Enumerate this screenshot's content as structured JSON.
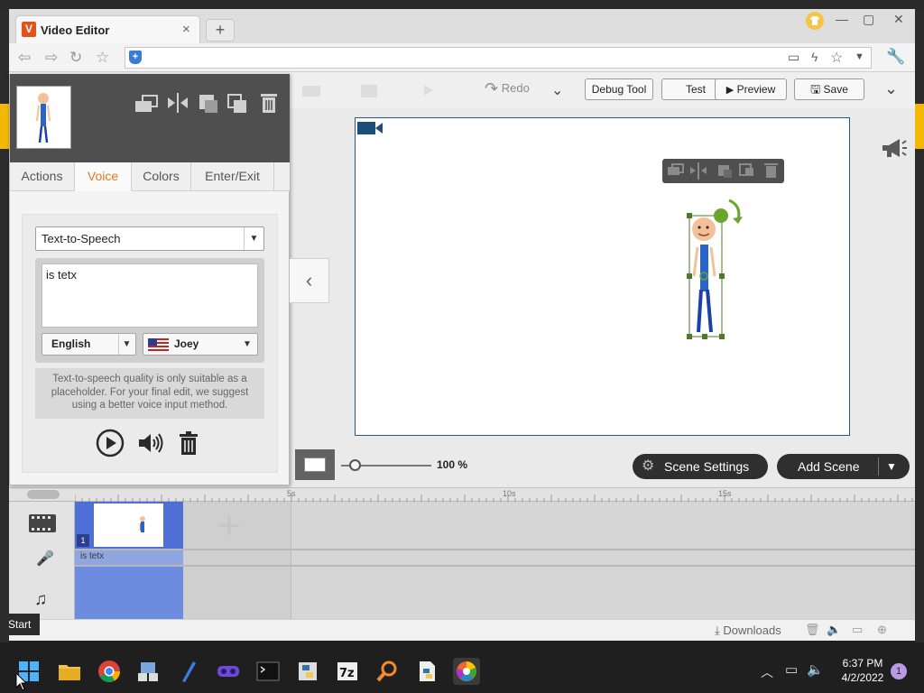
{
  "browser": {
    "tab_title": "Video Editor",
    "tab_favicon_letter": "V",
    "new_tab": "+",
    "tab_close": "×"
  },
  "toolbar": {
    "redo_label": "Redo",
    "debug_label": "Debug Tool",
    "test_label": "Test",
    "preview_label": "Preview",
    "save_label": "Save"
  },
  "panel": {
    "tabs": [
      "Actions",
      "Voice",
      "Colors",
      "Enter/Exit"
    ],
    "active_tab": "Voice",
    "voice": {
      "method": "Text-to-Speech",
      "text": "is tetx",
      "language": "English",
      "voice_name": "Joey",
      "note": "Text-to-speech quality is only suitable as a placeholder. For your final edit, we suggest using a better voice input method."
    }
  },
  "zoom": {
    "value": "100 %",
    "level": 0.15
  },
  "scene_settings_label": "Scene Settings",
  "add_scene_label": "Add Scene",
  "timeline": {
    "ticks": [
      "5s",
      "10s",
      "15s"
    ],
    "scene_number": "1",
    "voice_clip_text": "is tetx"
  },
  "statusbar": {
    "downloads_label": "Downloads"
  },
  "taskbar": {
    "start_tooltip": "Start",
    "time": "6:37 PM",
    "date": "4/2/2022",
    "notification_count": "1"
  },
  "colors": {
    "accent_orange": "#e07a24",
    "timeline_blue": "#4d6fd6",
    "stage_border": "#235a86"
  }
}
